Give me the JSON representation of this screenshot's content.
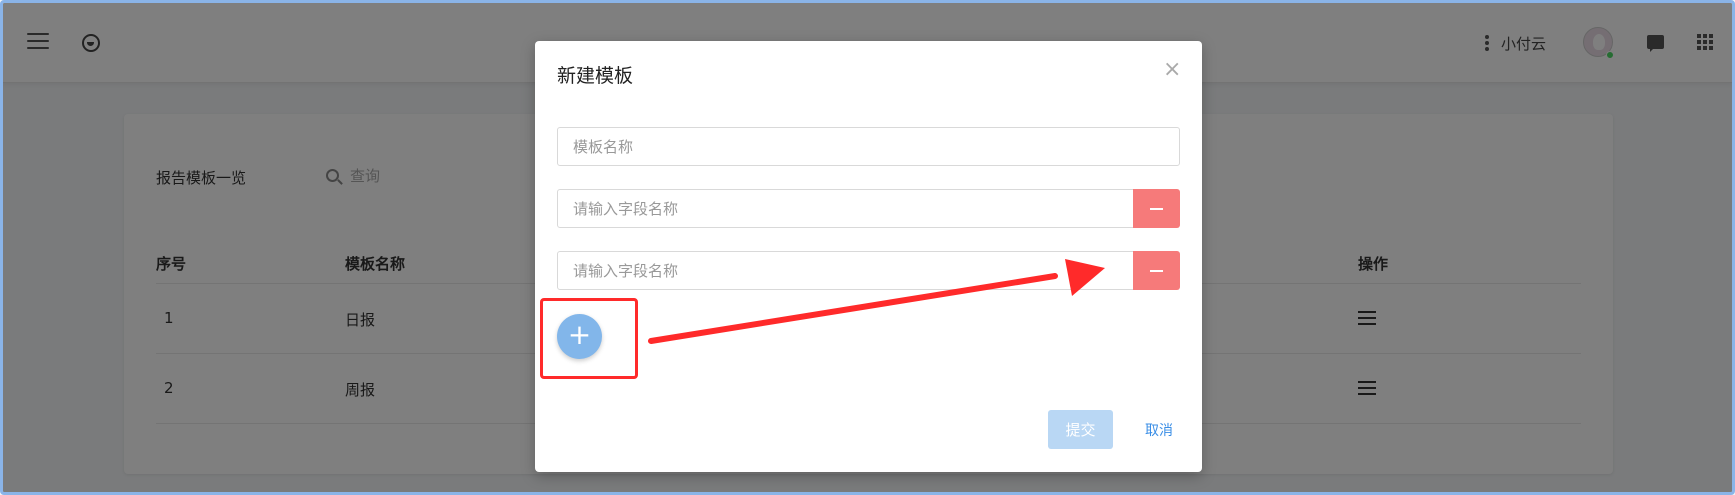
{
  "header": {
    "username": "小付云"
  },
  "page": {
    "title": "报告模板一览",
    "search_placeholder": "查询"
  },
  "table": {
    "columns": [
      "序号",
      "模板名称",
      "操作"
    ],
    "rows": [
      {
        "index": "1",
        "name": "日报"
      },
      {
        "index": "2",
        "name": "周报"
      }
    ]
  },
  "modal": {
    "title": "新建模板",
    "close_symbol": "×",
    "template_name_placeholder": "模板名称",
    "field_placeholder": "请输入字段名称",
    "add_symbol": "+",
    "submit_label": "提交",
    "cancel_label": "取消"
  },
  "colors": {
    "annotation_red": "#ff2a2a",
    "minus_button": "#f67a7a",
    "add_button": "#82b6ea",
    "submit_disabled": "#b9d7f4",
    "link_blue": "#3a8ee6"
  },
  "icons": [
    "hamburger-icon",
    "logo-icon",
    "kebab-icon",
    "avatar",
    "chat-icon",
    "apps-grid-icon",
    "search-icon",
    "list-menu-icon",
    "close-icon",
    "minus-icon",
    "plus-icon"
  ]
}
